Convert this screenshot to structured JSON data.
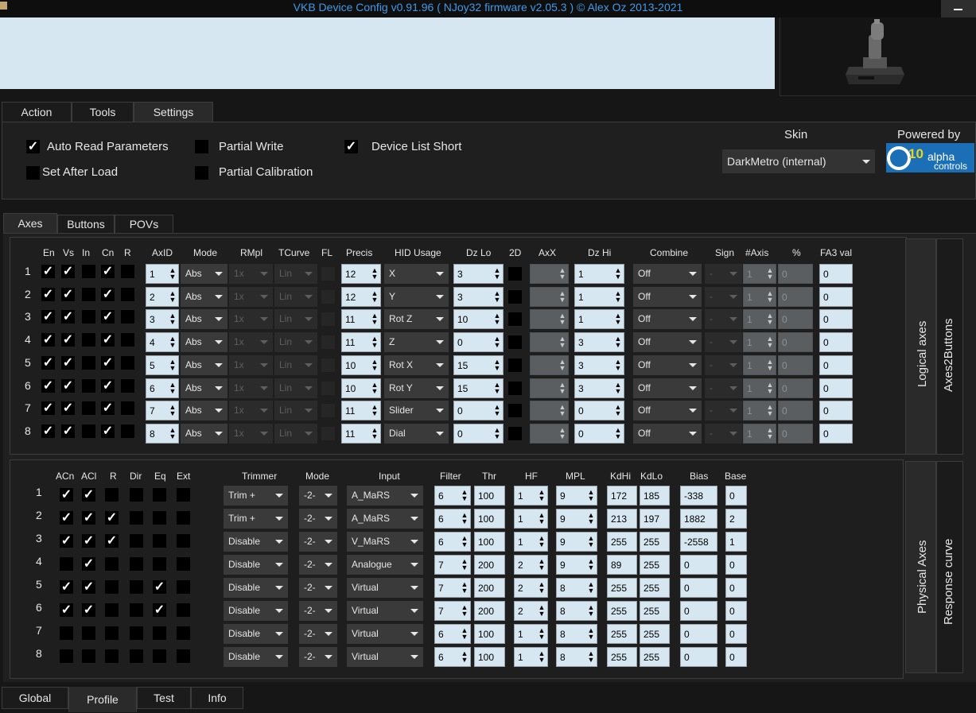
{
  "window": {
    "title": "VKB Device Config v0.91.96 ( NJoy32 firmware v2.05.3 ) © Alex Oz 2013-2021"
  },
  "main_tabs": [
    "Action",
    "Tools",
    "Settings"
  ],
  "settings": {
    "auto_read": "Auto Read Parameters",
    "set_after_load": "Set After Load",
    "partial_write": "Partial Write",
    "partial_calibration": "Partial Calibration",
    "device_list_short": "Device List Short",
    "skin_label": "Skin",
    "skin_value": "DarkMetro (internal)",
    "powered_by": "Powered by",
    "logo_text": "10 alpha controls"
  },
  "sub_tabs": [
    "Axes",
    "Buttons",
    "POVs"
  ],
  "logical": {
    "headers": {
      "en": "En",
      "vs": "Vs",
      "in": "In",
      "cn": "Cn",
      "r": "R",
      "axid": "AxID",
      "mode": "Mode",
      "rmpl": "RMpl",
      "tcurve": "TCurve",
      "fl": "FL",
      "precis": "Precis",
      "hid": "HID Usage",
      "dzlo": "Dz Lo",
      "twod": "2D",
      "axx": "AxX",
      "dzhi": "Dz Hi",
      "combine": "Combine",
      "sign": "Sign",
      "naxis": "#Axis",
      "pct": "%",
      "fa3": "FA3 val"
    },
    "side_tabs": [
      "Logical axes",
      "Axes2Buttons"
    ],
    "rows": [
      {
        "n": "1",
        "en": true,
        "vs": true,
        "in": false,
        "cn": true,
        "r": false,
        "axid": "1",
        "mode": "Abs",
        "rmpl": "1x",
        "tcurve": "Lin",
        "precis": "12",
        "hid": "X",
        "dzlo": "3",
        "dzhi": "1",
        "combine": "Off",
        "sign": "-",
        "naxis": "1",
        "pct": "0",
        "fa3": "0"
      },
      {
        "n": "2",
        "en": true,
        "vs": true,
        "in": false,
        "cn": true,
        "r": false,
        "axid": "2",
        "mode": "Abs",
        "rmpl": "1x",
        "tcurve": "Lin",
        "precis": "12",
        "hid": "Y",
        "dzlo": "3",
        "dzhi": "1",
        "combine": "Off",
        "sign": "-",
        "naxis": "1",
        "pct": "0",
        "fa3": "0"
      },
      {
        "n": "3",
        "en": true,
        "vs": true,
        "in": false,
        "cn": true,
        "r": false,
        "axid": "3",
        "mode": "Abs",
        "rmpl": "1x",
        "tcurve": "Lin",
        "precis": "11",
        "hid": "Rot Z",
        "dzlo": "10",
        "dzhi": "1",
        "combine": "Off",
        "sign": "-",
        "naxis": "1",
        "pct": "0",
        "fa3": "0"
      },
      {
        "n": "4",
        "en": true,
        "vs": true,
        "in": false,
        "cn": true,
        "r": false,
        "axid": "4",
        "mode": "Abs",
        "rmpl": "1x",
        "tcurve": "Lin",
        "precis": "11",
        "hid": "Z",
        "dzlo": "0",
        "dzhi": "3",
        "combine": "Off",
        "sign": "-",
        "naxis": "1",
        "pct": "0",
        "fa3": "0"
      },
      {
        "n": "5",
        "en": true,
        "vs": true,
        "in": false,
        "cn": true,
        "r": false,
        "axid": "5",
        "mode": "Abs",
        "rmpl": "1x",
        "tcurve": "Lin",
        "precis": "10",
        "hid": "Rot X",
        "dzlo": "15",
        "dzhi": "3",
        "combine": "Off",
        "sign": "-",
        "naxis": "1",
        "pct": "0",
        "fa3": "0"
      },
      {
        "n": "6",
        "en": true,
        "vs": true,
        "in": false,
        "cn": true,
        "r": false,
        "axid": "6",
        "mode": "Abs",
        "rmpl": "1x",
        "tcurve": "Lin",
        "precis": "10",
        "hid": "Rot Y",
        "dzlo": "15",
        "dzhi": "3",
        "combine": "Off",
        "sign": "-",
        "naxis": "1",
        "pct": "0",
        "fa3": "0"
      },
      {
        "n": "7",
        "en": true,
        "vs": true,
        "in": false,
        "cn": true,
        "r": false,
        "axid": "7",
        "mode": "Abs",
        "rmpl": "1x",
        "tcurve": "Lin",
        "precis": "11",
        "hid": "Slider",
        "dzlo": "0",
        "dzhi": "0",
        "combine": "Off",
        "sign": "-",
        "naxis": "1",
        "pct": "0",
        "fa3": "0"
      },
      {
        "n": "8",
        "en": true,
        "vs": true,
        "in": false,
        "cn": true,
        "r": false,
        "axid": "8",
        "mode": "Abs",
        "rmpl": "1x",
        "tcurve": "Lin",
        "precis": "11",
        "hid": "Dial",
        "dzlo": "0",
        "dzhi": "0",
        "combine": "Off",
        "sign": "-",
        "naxis": "1",
        "pct": "0",
        "fa3": "0"
      }
    ]
  },
  "physical": {
    "headers": {
      "acn": "ACn",
      "acl": "ACl",
      "r": "R",
      "dir": "Dir",
      "eq": "Eq",
      "ext": "Ext",
      "trimmer": "Trimmer",
      "mode": "Mode",
      "input": "Input",
      "filter": "Filter",
      "thr": "Thr",
      "hf": "HF",
      "mpl": "MPL",
      "kdhi": "KdHi",
      "kdlo": "KdLo",
      "bias": "Bias",
      "base": "Base"
    },
    "side_tabs": [
      "Physical Axes",
      "Response curve"
    ],
    "rows": [
      {
        "n": "1",
        "acn": true,
        "acl": true,
        "r": false,
        "dir": false,
        "eq": false,
        "ext": false,
        "trimmer": "Trim +",
        "mode": "-2-",
        "input": "A_MaRS",
        "filter": "6",
        "thr": "100",
        "hf": "1",
        "mpl": "9",
        "kdhi": "172",
        "kdlo": "185",
        "bias": "-338",
        "base": "0"
      },
      {
        "n": "2",
        "acn": true,
        "acl": true,
        "r": true,
        "dir": false,
        "eq": false,
        "ext": false,
        "trimmer": "Trim +",
        "mode": "-2-",
        "input": "A_MaRS",
        "filter": "6",
        "thr": "100",
        "hf": "1",
        "mpl": "9",
        "kdhi": "213",
        "kdlo": "197",
        "bias": "1882",
        "base": "2"
      },
      {
        "n": "3",
        "acn": true,
        "acl": true,
        "r": true,
        "dir": false,
        "eq": false,
        "ext": false,
        "trimmer": "Disable",
        "mode": "-2-",
        "input": "V_MaRS",
        "filter": "6",
        "thr": "100",
        "hf": "1",
        "mpl": "9",
        "kdhi": "255",
        "kdlo": "255",
        "bias": "-2558",
        "base": "1"
      },
      {
        "n": "4",
        "acn": false,
        "acl": true,
        "r": false,
        "dir": false,
        "eq": false,
        "ext": false,
        "trimmer": "Disable",
        "mode": "-2-",
        "input": "Analogue",
        "filter": "7",
        "thr": "200",
        "hf": "2",
        "mpl": "9",
        "kdhi": "89",
        "kdlo": "255",
        "bias": "0",
        "base": "0"
      },
      {
        "n": "5",
        "acn": true,
        "acl": true,
        "r": false,
        "dir": false,
        "eq": true,
        "ext": false,
        "trimmer": "Disable",
        "mode": "-2-",
        "input": "Virtual",
        "filter": "7",
        "thr": "200",
        "hf": "2",
        "mpl": "8",
        "kdhi": "255",
        "kdlo": "255",
        "bias": "0",
        "base": "0"
      },
      {
        "n": "6",
        "acn": true,
        "acl": true,
        "r": false,
        "dir": false,
        "eq": true,
        "ext": false,
        "trimmer": "Disable",
        "mode": "-2-",
        "input": "Virtual",
        "filter": "7",
        "thr": "200",
        "hf": "2",
        "mpl": "8",
        "kdhi": "255",
        "kdlo": "255",
        "bias": "0",
        "base": "0"
      },
      {
        "n": "7",
        "acn": false,
        "acl": false,
        "r": false,
        "dir": false,
        "eq": false,
        "ext": false,
        "trimmer": "Disable",
        "mode": "-2-",
        "input": "Virtual",
        "filter": "6",
        "thr": "100",
        "hf": "1",
        "mpl": "8",
        "kdhi": "255",
        "kdlo": "255",
        "bias": "0",
        "base": "0"
      },
      {
        "n": "8",
        "acn": false,
        "acl": false,
        "r": false,
        "dir": false,
        "eq": false,
        "ext": false,
        "trimmer": "Disable",
        "mode": "-2-",
        "input": "Virtual",
        "filter": "6",
        "thr": "100",
        "hf": "1",
        "mpl": "8",
        "kdhi": "255",
        "kdlo": "255",
        "bias": "0",
        "base": "0"
      }
    ]
  },
  "bottom_tabs": [
    "Global",
    "Profile",
    "Test",
    "Info"
  ]
}
